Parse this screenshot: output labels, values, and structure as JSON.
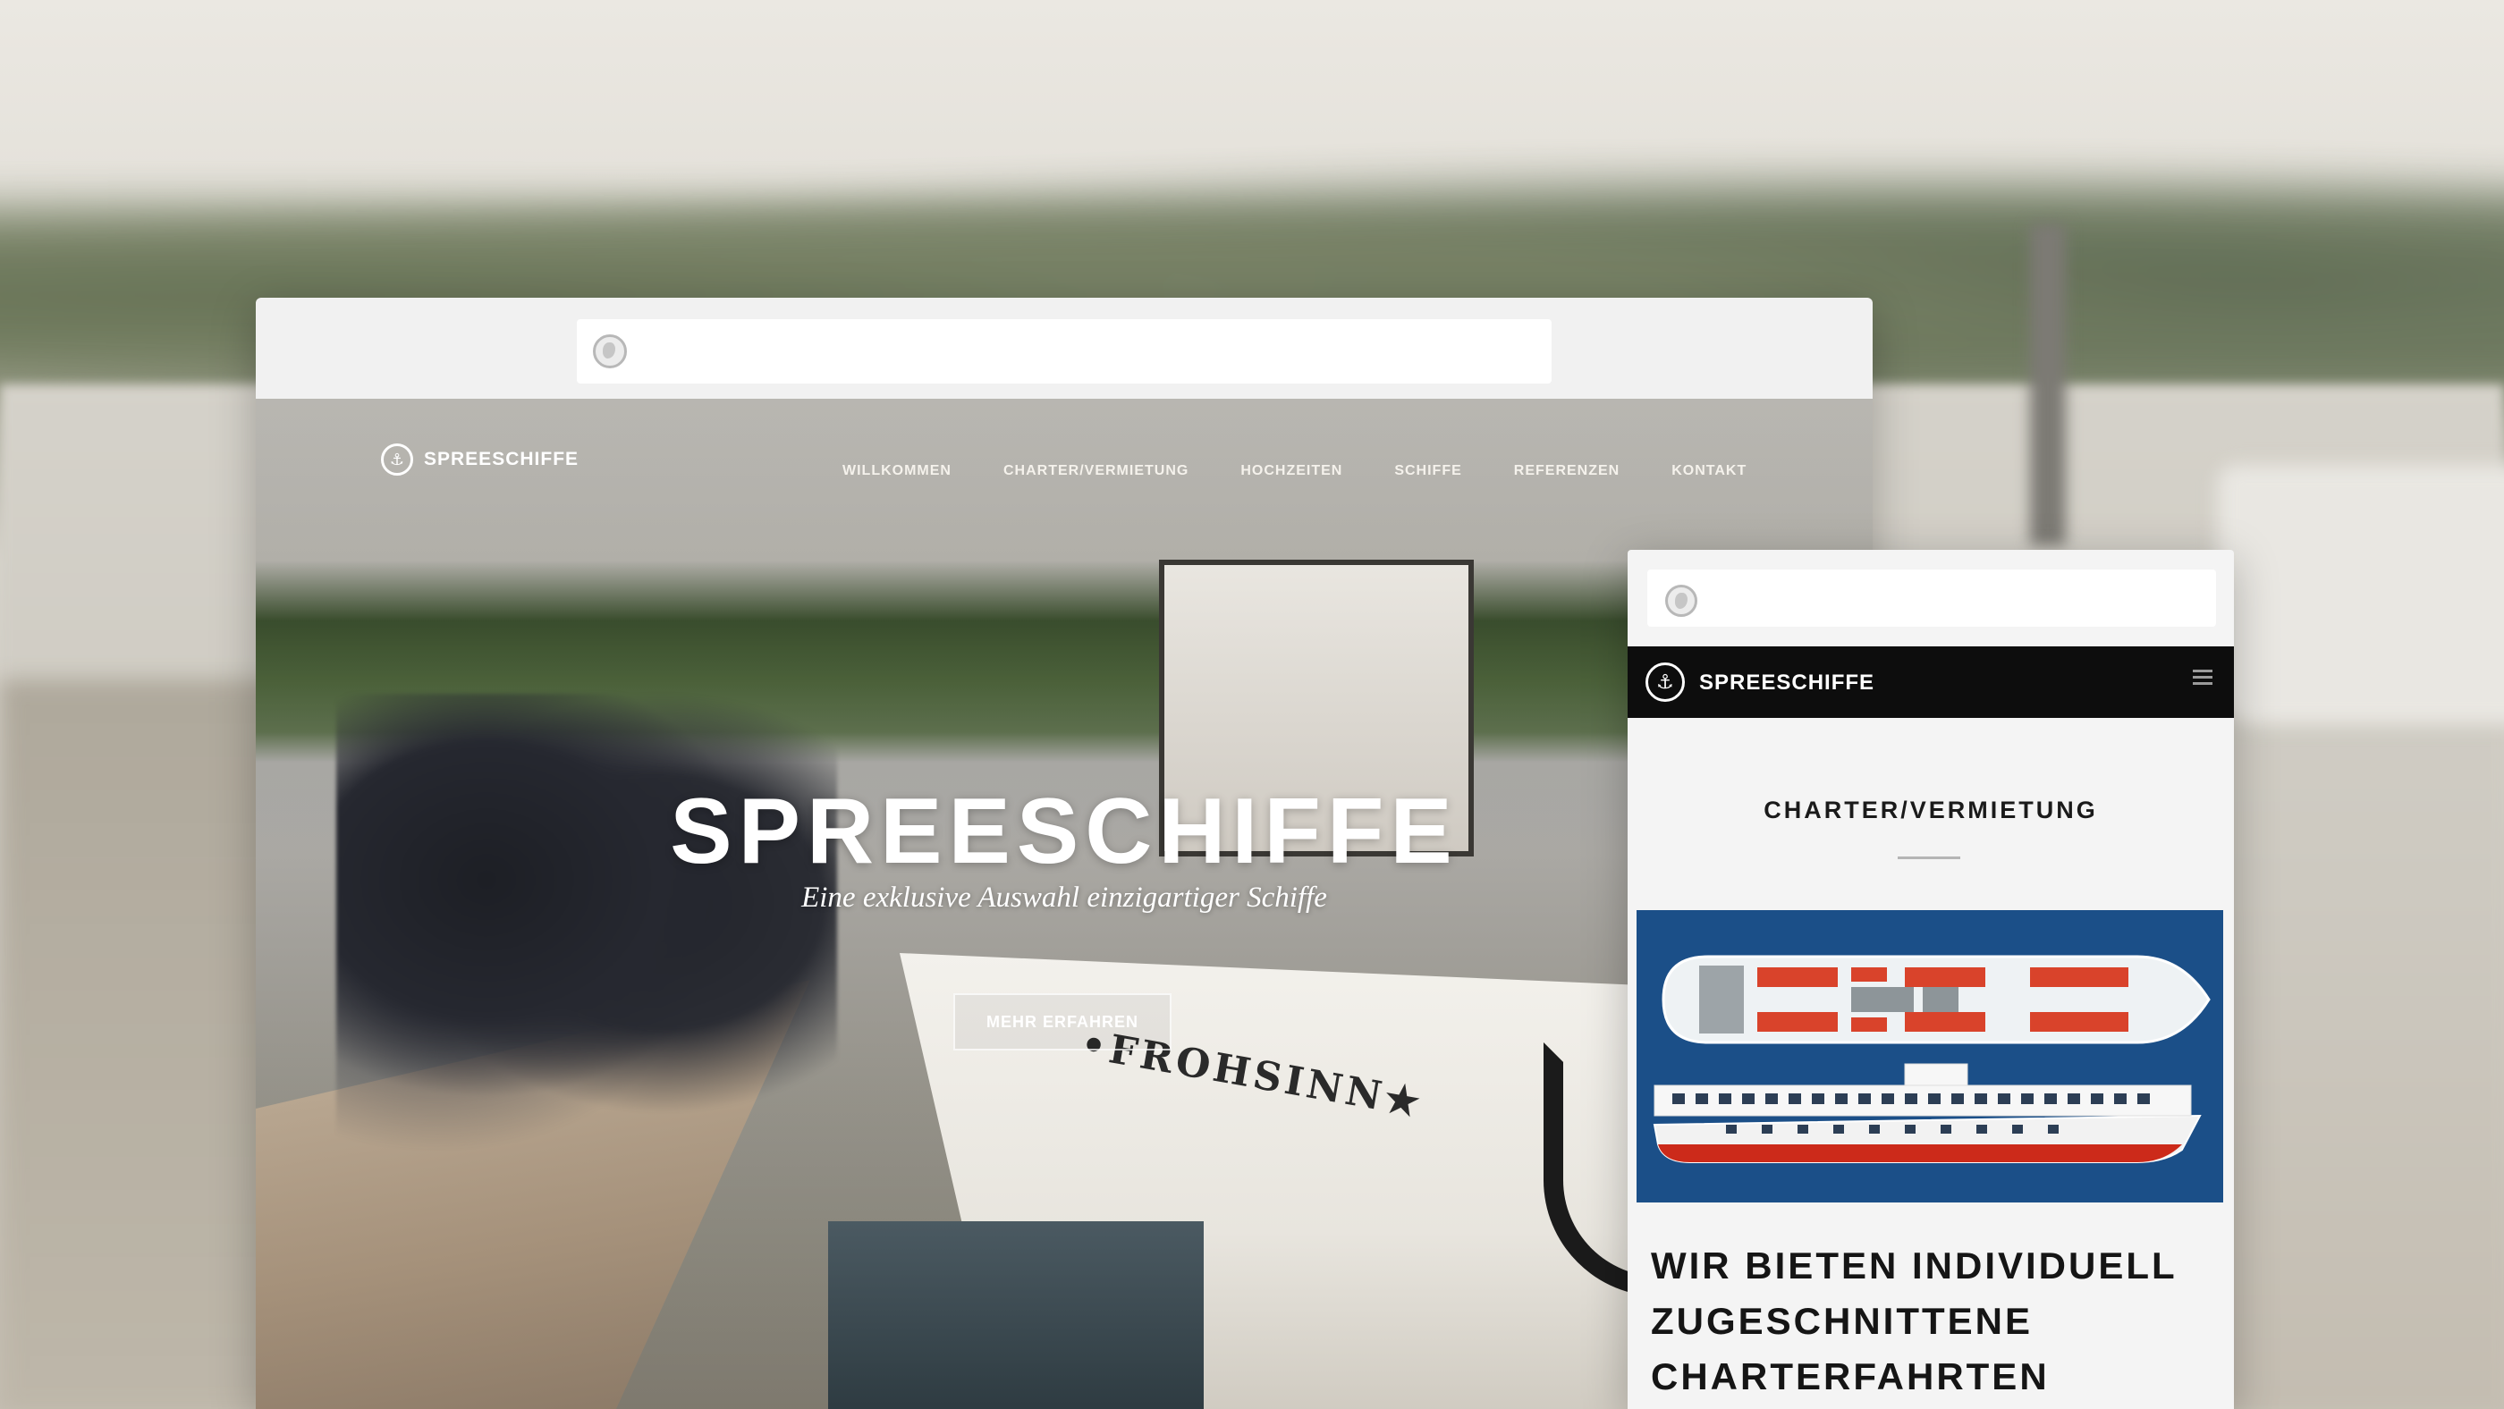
{
  "colors": {
    "mobile_header_bg": "#0d0d0d",
    "plan_bg": "#1b4f88",
    "plan_seats": "#d9432b",
    "hull_red": "#cc2a1a"
  },
  "icons": {
    "address_bar": "globe-icon",
    "logo": "anchor-icon",
    "mobile_menu": "hamburger-icon"
  },
  "desktop": {
    "logo": {
      "glyph": "⚓",
      "brand": "SPREESCHIFFE"
    },
    "nav": [
      {
        "label": "WILLKOMMEN"
      },
      {
        "label": "CHARTER/VERMIETUNG"
      },
      {
        "label": "HOCHZEITEN"
      },
      {
        "label": "SCHIFFE"
      },
      {
        "label": "REFERENZEN"
      },
      {
        "label": "KONTAKT"
      }
    ],
    "hero": {
      "title": "SPREESCHIFFE",
      "subtitle": "Eine exklusive Auswahl einzigartiger Schiffe",
      "button_label": "MEHR ERFAHREN"
    },
    "photo_text": {
      "ship_name": "•FROHSINN★"
    }
  },
  "mobile": {
    "logo": {
      "glyph": "⚓",
      "brand": "SPREESCHIFFE"
    },
    "section_title": "CHARTER/VERMIETUNG",
    "headline": "WIR BIETEN INDIVIDUELL ZUGESCHNITTENE CHARTERFAHRTEN"
  }
}
